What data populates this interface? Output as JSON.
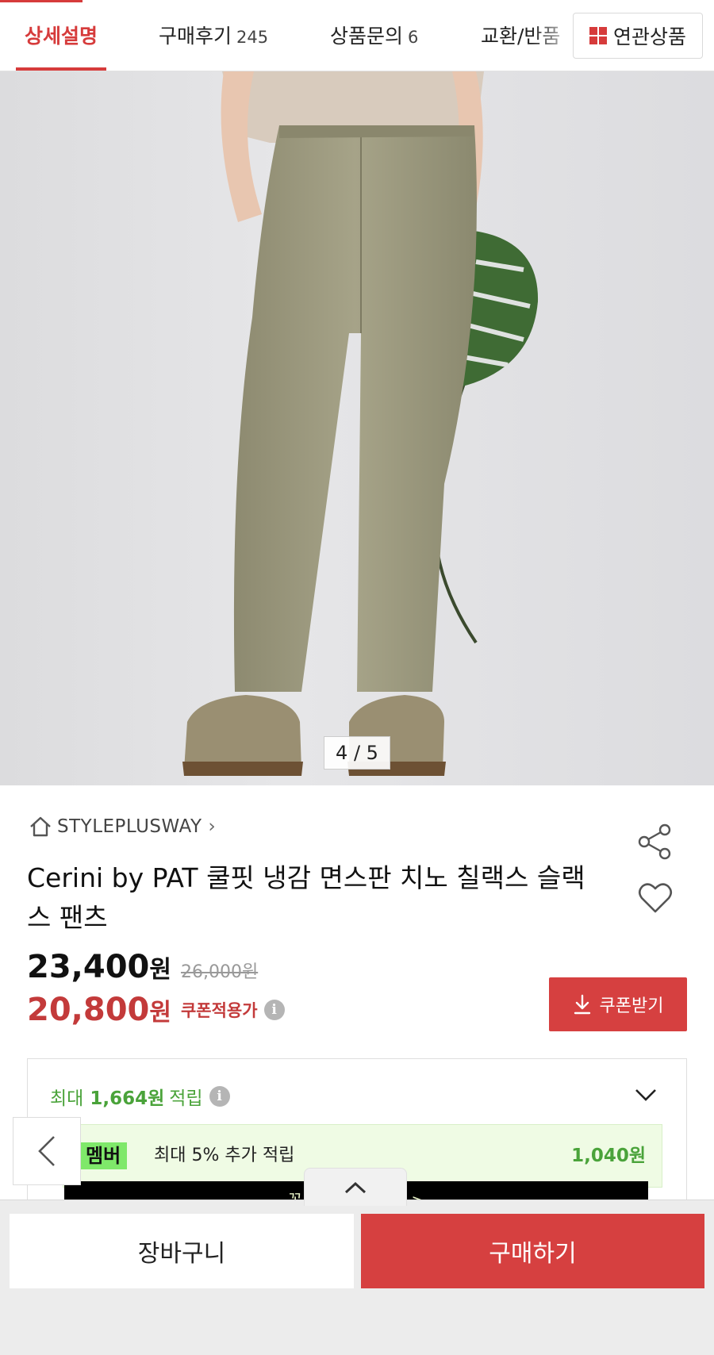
{
  "tabs": [
    {
      "label": "상세설명",
      "count": ""
    },
    {
      "label": "구매후기",
      "count": "245"
    },
    {
      "label": "상품문의",
      "count": "6"
    },
    {
      "label": "교환/반품",
      "count": ""
    }
  ],
  "related_label": "연관상품",
  "gallery": {
    "counter": "4 / 5",
    "current": 4,
    "total": 5
  },
  "brand": {
    "name": "STYLEPLUSWAY",
    "chevron": "›"
  },
  "product": {
    "title": "Cerini by PAT 쿨핏 냉감 면스판 치노 칠랙스 슬랙스 팬츠",
    "price": "23,400",
    "price_unit": "원",
    "original_price": "26,000원",
    "coupon_price": "20,800",
    "coupon_price_unit": "원",
    "coupon_price_label": "쿠폰적용가"
  },
  "coupon_button": "쿠폰받기",
  "points": {
    "prefix": "최대",
    "amount": "1,664원",
    "suffix": "적립",
    "member_badge": "멤버",
    "member_text": "최대 5% 추가 적립",
    "member_amount": "1,040원",
    "banner_text": "꼭! 시작하고 받기 >"
  },
  "bottom": {
    "cart": "장바구니",
    "buy": "구매하기"
  },
  "colors": {
    "accent": "#d63b3b",
    "points_green": "#4aa33a",
    "member_green": "#7fe86a"
  },
  "icons": [
    "grid-icon",
    "home-icon",
    "share-icon",
    "heart-icon",
    "info-icon",
    "download-icon",
    "chevron-down-icon",
    "chevron-left-icon",
    "chevron-up-icon"
  ]
}
